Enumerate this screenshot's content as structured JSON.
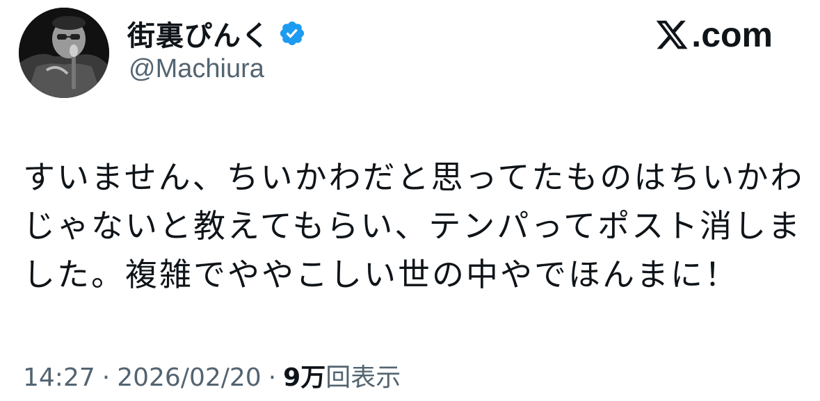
{
  "author": {
    "display_name": "街裏ぴんく",
    "handle": "@Machiura",
    "verified": true,
    "avatar_icon": "profile-photo"
  },
  "brand": {
    "x_icon": "x-logo-icon",
    "suffix": ".com"
  },
  "tweet": {
    "lines": [
      "すいません、ちいかわだと思ってたものはちいかわ",
      "じゃないと教えてもらい、テンパってポスト消しま",
      "した。複雑でややこしい世の中やでほんまに！"
    ]
  },
  "meta": {
    "time": "14:27",
    "separator": "·",
    "date": "2026/02/20",
    "views_count": "9万",
    "views_label": "回表示"
  },
  "colors": {
    "text": "#0f1419",
    "secondary": "#536471",
    "verified_blue": "#1d9bf0"
  }
}
